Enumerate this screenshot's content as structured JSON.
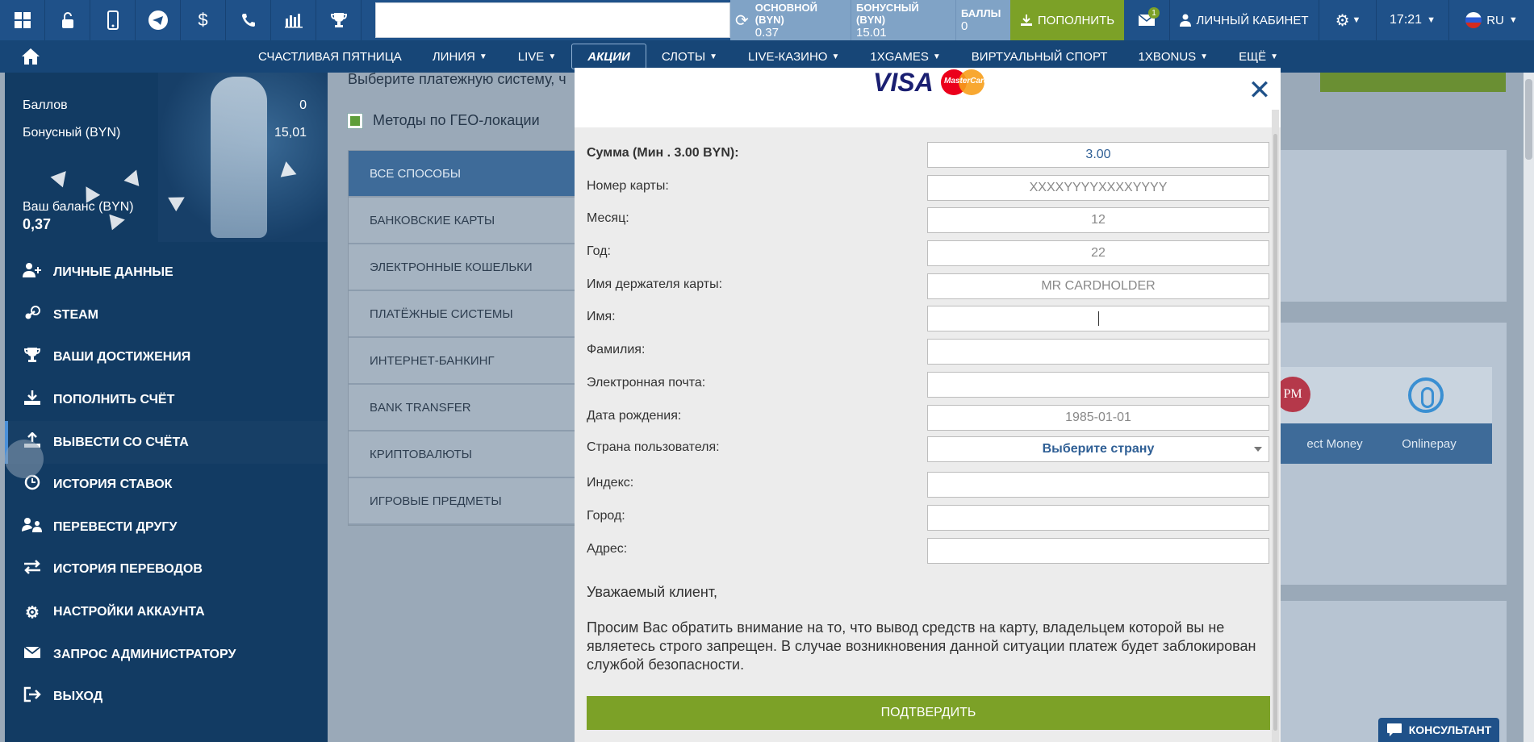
{
  "topbar": {
    "icons": [
      "windows-icon",
      "lock-icon",
      "mobile-icon",
      "telegram-icon",
      "dollar-icon",
      "phone-icon",
      "statistics-icon",
      "trophy-icon"
    ],
    "balances": [
      {
        "label": "Основной (BYN)",
        "value": "0.37"
      },
      {
        "label": "Бонусный (BYN)",
        "value": "15.01"
      },
      {
        "label": "Баллы",
        "value": "0"
      }
    ],
    "deposit_label": "ПОПОЛНИТЬ",
    "mail_count": "1",
    "cabinet_label": "ЛИЧНЫЙ КАБИНЕТ",
    "time": "17:21",
    "lang": "RU"
  },
  "nav": {
    "items": [
      "СЧАСТЛИВАЯ ПЯТНИЦА",
      "ЛИНИЯ",
      "LIVE",
      "АКЦИИ",
      "СЛОТЫ",
      "LIVE-КАЗИНО",
      "1XGAMES",
      "ВИРТУАЛЬНЫЙ СПОРТ",
      "1XBONUS",
      "ЕЩЁ"
    ],
    "active_index": 3
  },
  "sidebar": {
    "points_label": "Баллов",
    "points_value": "0",
    "bonus_label": "Бонусный (BYN)",
    "bonus_value": "15,01",
    "balance_label": "Ваш баланс (BYN)",
    "balance_value": "0,37",
    "menu": [
      {
        "label": "ЛИЧНЫЕ ДАННЫЕ",
        "icon": "user-plus-icon"
      },
      {
        "label": "STEAM",
        "icon": "steam-icon"
      },
      {
        "label": "ВАШИ ДОСТИЖЕНИЯ",
        "icon": "trophy-icon"
      },
      {
        "label": "ПОПОЛНИТЬ СЧЁТ",
        "icon": "download-icon"
      },
      {
        "label": "ВЫВЕСТИ СО СЧЁТА",
        "icon": "upload-icon"
      },
      {
        "label": "ИСТОРИЯ СТАВОК",
        "icon": "clock-icon"
      },
      {
        "label": "ПЕРЕВЕСТИ ДРУГУ",
        "icon": "transfer-icon"
      },
      {
        "label": "ИСТОРИЯ ПЕРЕВОДОВ",
        "icon": "arrows-icon"
      },
      {
        "label": "НАСТРОЙКИ АККАУНТА",
        "icon": "gears-icon"
      },
      {
        "label": "ЗАПРОС АДМИНИСТРАТОРУ",
        "icon": "envelope-icon"
      },
      {
        "label": "ВЫХОД",
        "icon": "logout-icon"
      }
    ],
    "active_index": 4
  },
  "main": {
    "intro_text": "Выберите платежную систему, ч",
    "geo_label": "Методы по ГЕО-локации",
    "methods": [
      "ВСЕ СПОСОБЫ",
      "БАНКОВСКИЕ КАРТЫ",
      "ЭЛЕКТРОННЫЕ КОШЕЛЬКИ",
      "ПЛАТЁЖНЫЕ СИСТЕМЫ",
      "ИНТЕРНЕТ-БАНКИНГ",
      "BANK TRANSFER",
      "КРИПТОВАЛЮТЫ",
      "ИГРОВЫЕ ПРЕДМЕТЫ"
    ],
    "pay_cards": [
      {
        "caption": "ect Money",
        "logo": "PM"
      },
      {
        "caption": "Onlinepay",
        "logo": ""
      }
    ]
  },
  "modal": {
    "brand_visa": "VISA",
    "brand_mc": "MasterCard",
    "fields": [
      {
        "label": "Сумма (Мин . 3.00 BYN):",
        "value": "3.00",
        "placeholder": "",
        "bold": true
      },
      {
        "label": "Номер карты:",
        "value": "",
        "placeholder": "XXXXYYYYXXXXYYYY"
      },
      {
        "label": "Месяц:",
        "value": "",
        "placeholder": "12"
      },
      {
        "label": "Год:",
        "value": "",
        "placeholder": "22"
      },
      {
        "label": "Имя держателя карты:",
        "value": "",
        "placeholder": "MR CARDHOLDER"
      },
      {
        "label": "Имя:",
        "value": "",
        "placeholder": "",
        "focused": true
      },
      {
        "label": "Фамилия:",
        "value": "",
        "placeholder": ""
      },
      {
        "label": "Электронная почта:",
        "value": "",
        "placeholder": ""
      },
      {
        "label": "Дата рождения:",
        "value": "",
        "placeholder": "1985-01-01"
      },
      {
        "label": "Страна пользователя:",
        "value": "Выберите страну",
        "placeholder": "",
        "select": true
      },
      {
        "label": "Индекс:",
        "value": "",
        "placeholder": ""
      },
      {
        "label": "Город:",
        "value": "",
        "placeholder": ""
      },
      {
        "label": "Адрес:",
        "value": "",
        "placeholder": ""
      }
    ],
    "notice_title": "Уважаемый клиент,",
    "notice_text": "Просим Вас обратить внимание на то, что вывод средств на карту, владельцем которой вы не являетесь строго запрещен. В случае возникновения данной ситуации платеж будет заблокирован службой безопасности.",
    "confirm_label": "ПОДТВЕРДИТЬ"
  },
  "consultant_label": "КОНСУЛЬТАНТ"
}
